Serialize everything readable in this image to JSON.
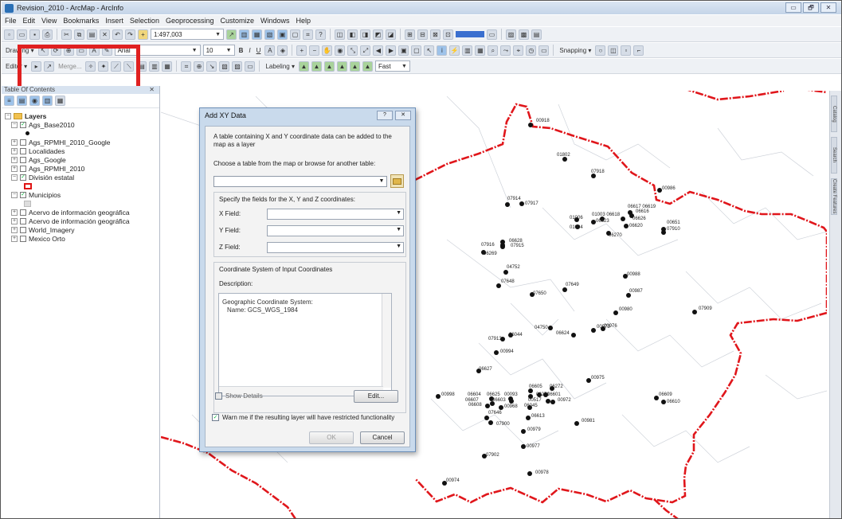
{
  "window": {
    "title": "Revision_2010 - ArcMap - ArcInfo",
    "controls": [
      "▭",
      "🗗",
      "✕"
    ]
  },
  "menu": [
    "File",
    "Edit",
    "View",
    "Bookmarks",
    "Insert",
    "Selection",
    "Geoprocessing",
    "Customize",
    "Windows",
    "Help"
  ],
  "toolbar1": {
    "scale": "1:497,003"
  },
  "toolbar2": {
    "drawing_label": "Drawing ▾",
    "font": "Arial",
    "font_size": "10",
    "snapping_label": "Snapping ▾"
  },
  "toolbar3": {
    "editor_label": "Editor ▾",
    "merge_label": "Merge...",
    "labeling_label": "Labeling ▾",
    "fast_label": "Fast"
  },
  "toc": {
    "header": "Table Of Contents",
    "root": "Layers",
    "layers": [
      {
        "name": "Ags_Base2010",
        "checked": true,
        "expanded": true,
        "legend": "dot"
      },
      {
        "name": "Ags_RPMHI_2010_Google",
        "checked": false,
        "expanded": false
      },
      {
        "name": "Localidades",
        "checked": false,
        "expanded": false
      },
      {
        "name": "Ags_Google",
        "checked": false,
        "expanded": false
      },
      {
        "name": "Ags_RPMHI_2010",
        "checked": false,
        "expanded": false
      },
      {
        "name": "División estatal",
        "checked": true,
        "expanded": true,
        "legend": "poly"
      },
      {
        "name": "Municipios",
        "checked": true,
        "expanded": true,
        "legend": "fill"
      },
      {
        "name": "Acervo de información geográfica",
        "checked": false,
        "expanded": false
      },
      {
        "name": "Acervo de información geográfica",
        "checked": false,
        "expanded": false
      },
      {
        "name": "World_Imagery",
        "checked": false,
        "expanded": false
      },
      {
        "name": "Mexico Orto",
        "checked": false,
        "expanded": false
      }
    ]
  },
  "dialog": {
    "title": "Add XY Data",
    "intro": "A table containing X and Y coordinate data can be added to the map as a layer",
    "choose_label": "Choose a table from the map or browse for another table:",
    "fields_group_label": "Specify the fields for the X, Y and Z coordinates:",
    "x_label": "X Field:",
    "y_label": "Y Field:",
    "z_label": "Z Field:",
    "x_value": "",
    "y_value": "",
    "z_value": "",
    "coord_label": "Coordinate System of Input Coordinates",
    "description_label": "Description:",
    "description_line1": "Geographic Coordinate System:",
    "description_line2": "Name: GCS_WGS_1984",
    "show_details": "Show Details",
    "edit_button": "Edit...",
    "warn_label": "Warn me if the resulting layer will have restricted functionality",
    "warn_checked": true,
    "ok_button": "OK",
    "cancel_button": "Cancel"
  },
  "sidebar_right": [
    "Catalog",
    "Search",
    "Create Features"
  ],
  "map": {
    "boundary_color": "#e0161b",
    "point_labels": [
      {
        "label": "00918"
      },
      {
        "label": "01802"
      },
      {
        "label": "07918"
      },
      {
        "label": "00986"
      },
      {
        "label": "07914"
      },
      {
        "label": "07917"
      },
      {
        "label": "06617 06619"
      },
      {
        "label": "06616"
      },
      {
        "label": "01003 06618"
      },
      {
        "label": "06626"
      },
      {
        "label": "01006"
      },
      {
        "label": "06623"
      },
      {
        "label": "06620"
      },
      {
        "label": "01004"
      },
      {
        "label": "00651"
      },
      {
        "label": "07910"
      },
      {
        "label": "06270"
      },
      {
        "label": "07916"
      },
      {
        "label": "06628"
      },
      {
        "label": "07915"
      },
      {
        "label": "06269"
      },
      {
        "label": "04752"
      },
      {
        "label": "00988"
      },
      {
        "label": "07648"
      },
      {
        "label": "07649"
      },
      {
        "label": "07650"
      },
      {
        "label": "00987"
      },
      {
        "label": "00980"
      },
      {
        "label": "07909"
      },
      {
        "label": "04750"
      },
      {
        "label": "00973"
      },
      {
        "label": "00976"
      },
      {
        "label": "06624"
      },
      {
        "label": "07913"
      },
      {
        "label": "06044"
      },
      {
        "label": "00994"
      },
      {
        "label": "06627"
      },
      {
        "label": "00975"
      },
      {
        "label": "06605"
      },
      {
        "label": "06272"
      },
      {
        "label": "00998"
      },
      {
        "label": "06604"
      },
      {
        "label": "06625"
      },
      {
        "label": "00093"
      },
      {
        "label": "06271"
      },
      {
        "label": "06601"
      },
      {
        "label": "06609"
      },
      {
        "label": "06607"
      },
      {
        "label": "06603"
      },
      {
        "label": "00517"
      },
      {
        "label": "00972"
      },
      {
        "label": "06608"
      },
      {
        "label": "00968"
      },
      {
        "label": "06045"
      },
      {
        "label": "07646"
      },
      {
        "label": "06613"
      },
      {
        "label": "00981"
      },
      {
        "label": "07900"
      },
      {
        "label": "00979"
      },
      {
        "label": "00977"
      },
      {
        "label": "07902"
      },
      {
        "label": "00978"
      },
      {
        "label": "00974"
      },
      {
        "label": "06610"
      }
    ]
  }
}
